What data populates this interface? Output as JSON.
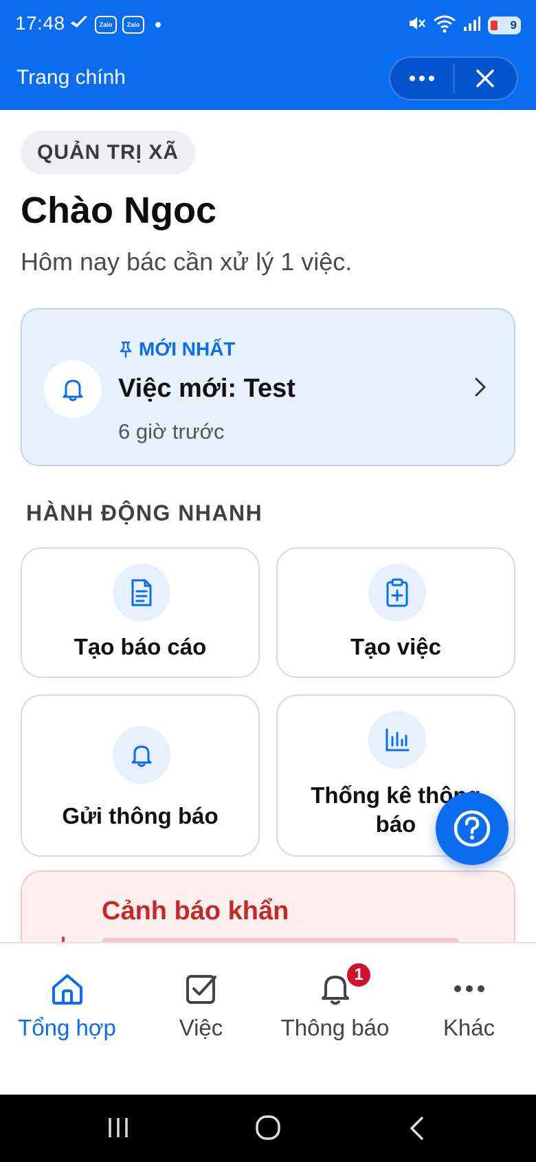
{
  "status_bar": {
    "time": "17:48",
    "zalo_label": "Zalo",
    "battery": "9"
  },
  "header": {
    "title": "Trang chính"
  },
  "role_chip": "QUẢN TRỊ XÃ",
  "greeting": "Chào Ngoc",
  "subtitle": "Hôm nay bác cần xử lý 1 việc.",
  "latest": {
    "tag": "MỚI NHẤT",
    "title": "Việc mới: Test",
    "time": "6 giờ trước"
  },
  "quick_actions": {
    "section_title": "HÀNH ĐỘNG NHANH",
    "items": [
      {
        "label": "Tạo báo cáo",
        "icon": "document-icon"
      },
      {
        "label": "Tạo việc",
        "icon": "clipboard-plus-icon"
      },
      {
        "label": "Gửi thông báo",
        "icon": "bell-icon"
      },
      {
        "label": "Thống kê thông báo",
        "icon": "bar-chart-icon"
      }
    ]
  },
  "urgent": {
    "title": "Cảnh báo khẩn"
  },
  "bottom_nav": {
    "items": [
      {
        "label": "Tổng hợp",
        "icon": "home-icon",
        "active": true
      },
      {
        "label": "Việc",
        "icon": "checkbox-icon"
      },
      {
        "label": "Thông báo",
        "icon": "bell-icon",
        "badge": "1"
      },
      {
        "label": "Khác",
        "icon": "more-icon"
      }
    ]
  },
  "colors": {
    "primary": "#0a6cf0",
    "danger": "#c62828",
    "badge": "#d0112b"
  }
}
